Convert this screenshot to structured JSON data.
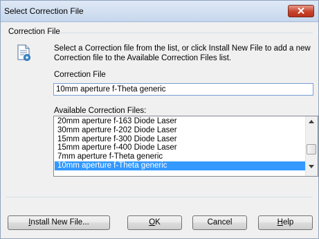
{
  "window": {
    "title": "Select Correction File"
  },
  "group": {
    "label": "Correction File"
  },
  "description": "Select a Correction file from the list, or click Install New File to add a new Correction file to the Available Correction Files list.",
  "correction_file": {
    "label": "Correction File",
    "value": "10mm aperture f-Theta generic"
  },
  "available": {
    "label": "Available Correction Files:",
    "items": [
      "20mm aperture f-163 Diode Laser",
      "30mm aperture f-202 Diode Laser",
      "15mm aperture f-300 Diode Laser",
      "15mm aperture f-400 Diode Laser",
      "7mm aperture f-Theta generic",
      "10mm aperture f-Theta generic"
    ],
    "selected_index": 5
  },
  "buttons": {
    "install": {
      "prefix": "",
      "accel": "I",
      "rest": "nstall New File..."
    },
    "ok": {
      "prefix": "",
      "accel": "O",
      "rest": "K"
    },
    "cancel": "Cancel",
    "help": {
      "prefix": "",
      "accel": "H",
      "rest": "elp"
    }
  },
  "colors": {
    "selection": "#3399ff",
    "close_button": "#c8432c",
    "title_bar": "#c7d7ec"
  }
}
